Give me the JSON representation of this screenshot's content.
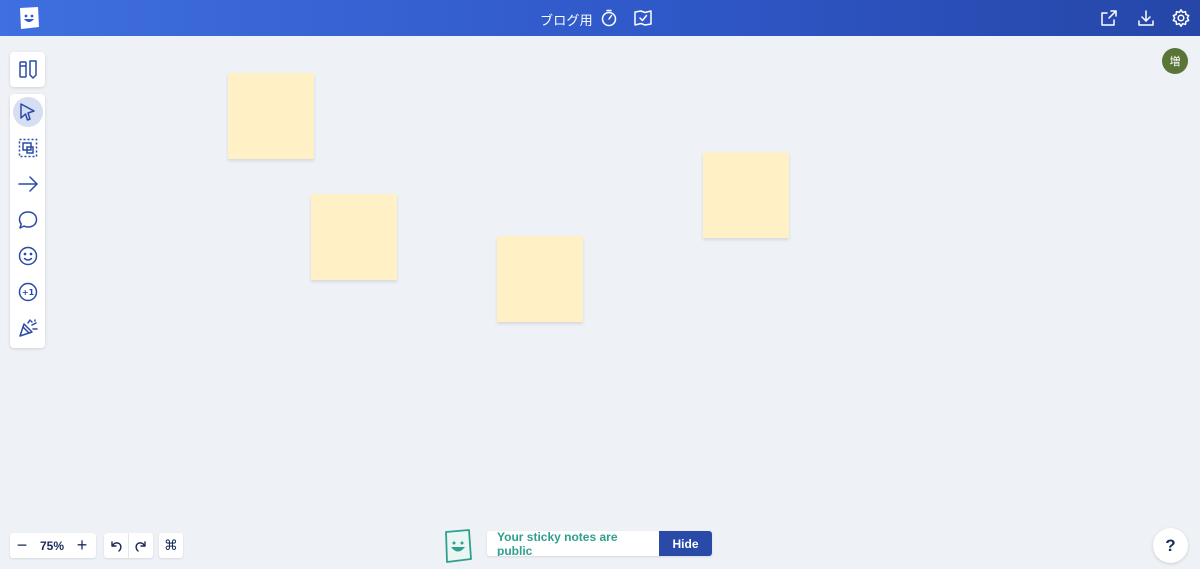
{
  "header": {
    "title": "ブログ用",
    "icons": [
      "app-logo",
      "timer-icon",
      "board-check-icon",
      "share-icon",
      "download-icon",
      "settings-icon"
    ]
  },
  "user": {
    "avatar_initial": "増"
  },
  "tools": {
    "top_panel": [
      "sticky-pen-icon"
    ],
    "main_panel": [
      "select-cursor-icon",
      "multi-select-icon",
      "arrow-icon",
      "comment-icon",
      "emoji-icon",
      "plus-one-icon",
      "party-popper-icon"
    ],
    "active": "select-cursor-icon"
  },
  "board": {
    "sticky_notes": [
      {
        "color": "#fff1c5",
        "text": ""
      },
      {
        "color": "#fff1c5",
        "text": ""
      },
      {
        "color": "#fff1c5",
        "text": ""
      },
      {
        "color": "#fff1c5",
        "text": ""
      }
    ]
  },
  "bottom": {
    "zoom_out_label": "−",
    "zoom_value": "75%",
    "zoom_in_label": "+",
    "public_notice": "Your sticky notes are public",
    "hide_label": "Hide",
    "help_label": "?"
  },
  "colors": {
    "header_start": "#3f6fe0",
    "header_end": "#2646a8",
    "canvas": "#eef1f5",
    "sticky": "#fff1c5",
    "accent_teal": "#2f9f8f",
    "hide_button": "#2a4aa7",
    "avatar": "#5b7437"
  }
}
